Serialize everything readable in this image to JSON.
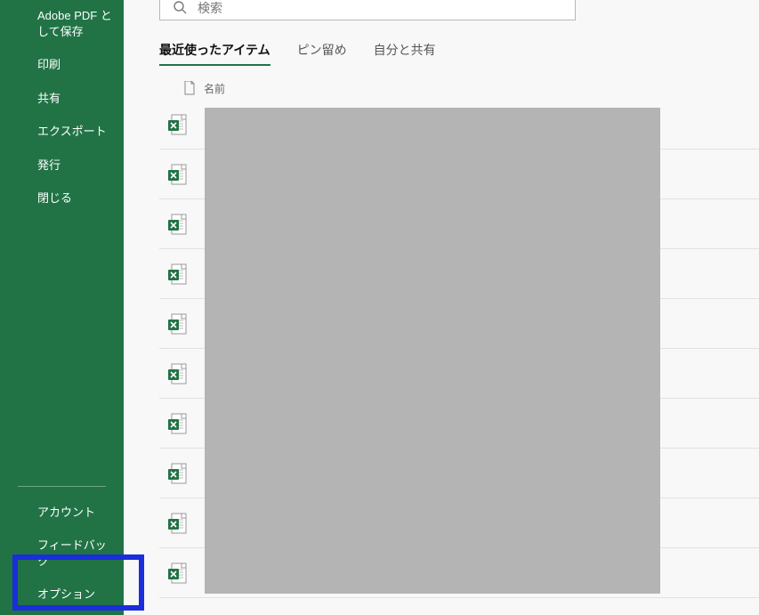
{
  "sidebar": {
    "items": [
      {
        "label": "Adobe PDF として保存"
      },
      {
        "label": "印刷"
      },
      {
        "label": "共有"
      },
      {
        "label": "エクスポート"
      },
      {
        "label": "発行"
      },
      {
        "label": "閉じる"
      }
    ],
    "bottom": [
      {
        "label": "アカウント"
      },
      {
        "label": "フィードバック"
      },
      {
        "label": "オプション"
      }
    ]
  },
  "search": {
    "placeholder": "検索"
  },
  "tabs": [
    {
      "label": "最近使ったアイテム",
      "active": true
    },
    {
      "label": "ピン留め",
      "active": false
    },
    {
      "label": "自分と共有",
      "active": false
    }
  ],
  "list": {
    "header_name": "名前",
    "rows": [
      {},
      {},
      {},
      {},
      {},
      {},
      {},
      {},
      {},
      {}
    ]
  }
}
